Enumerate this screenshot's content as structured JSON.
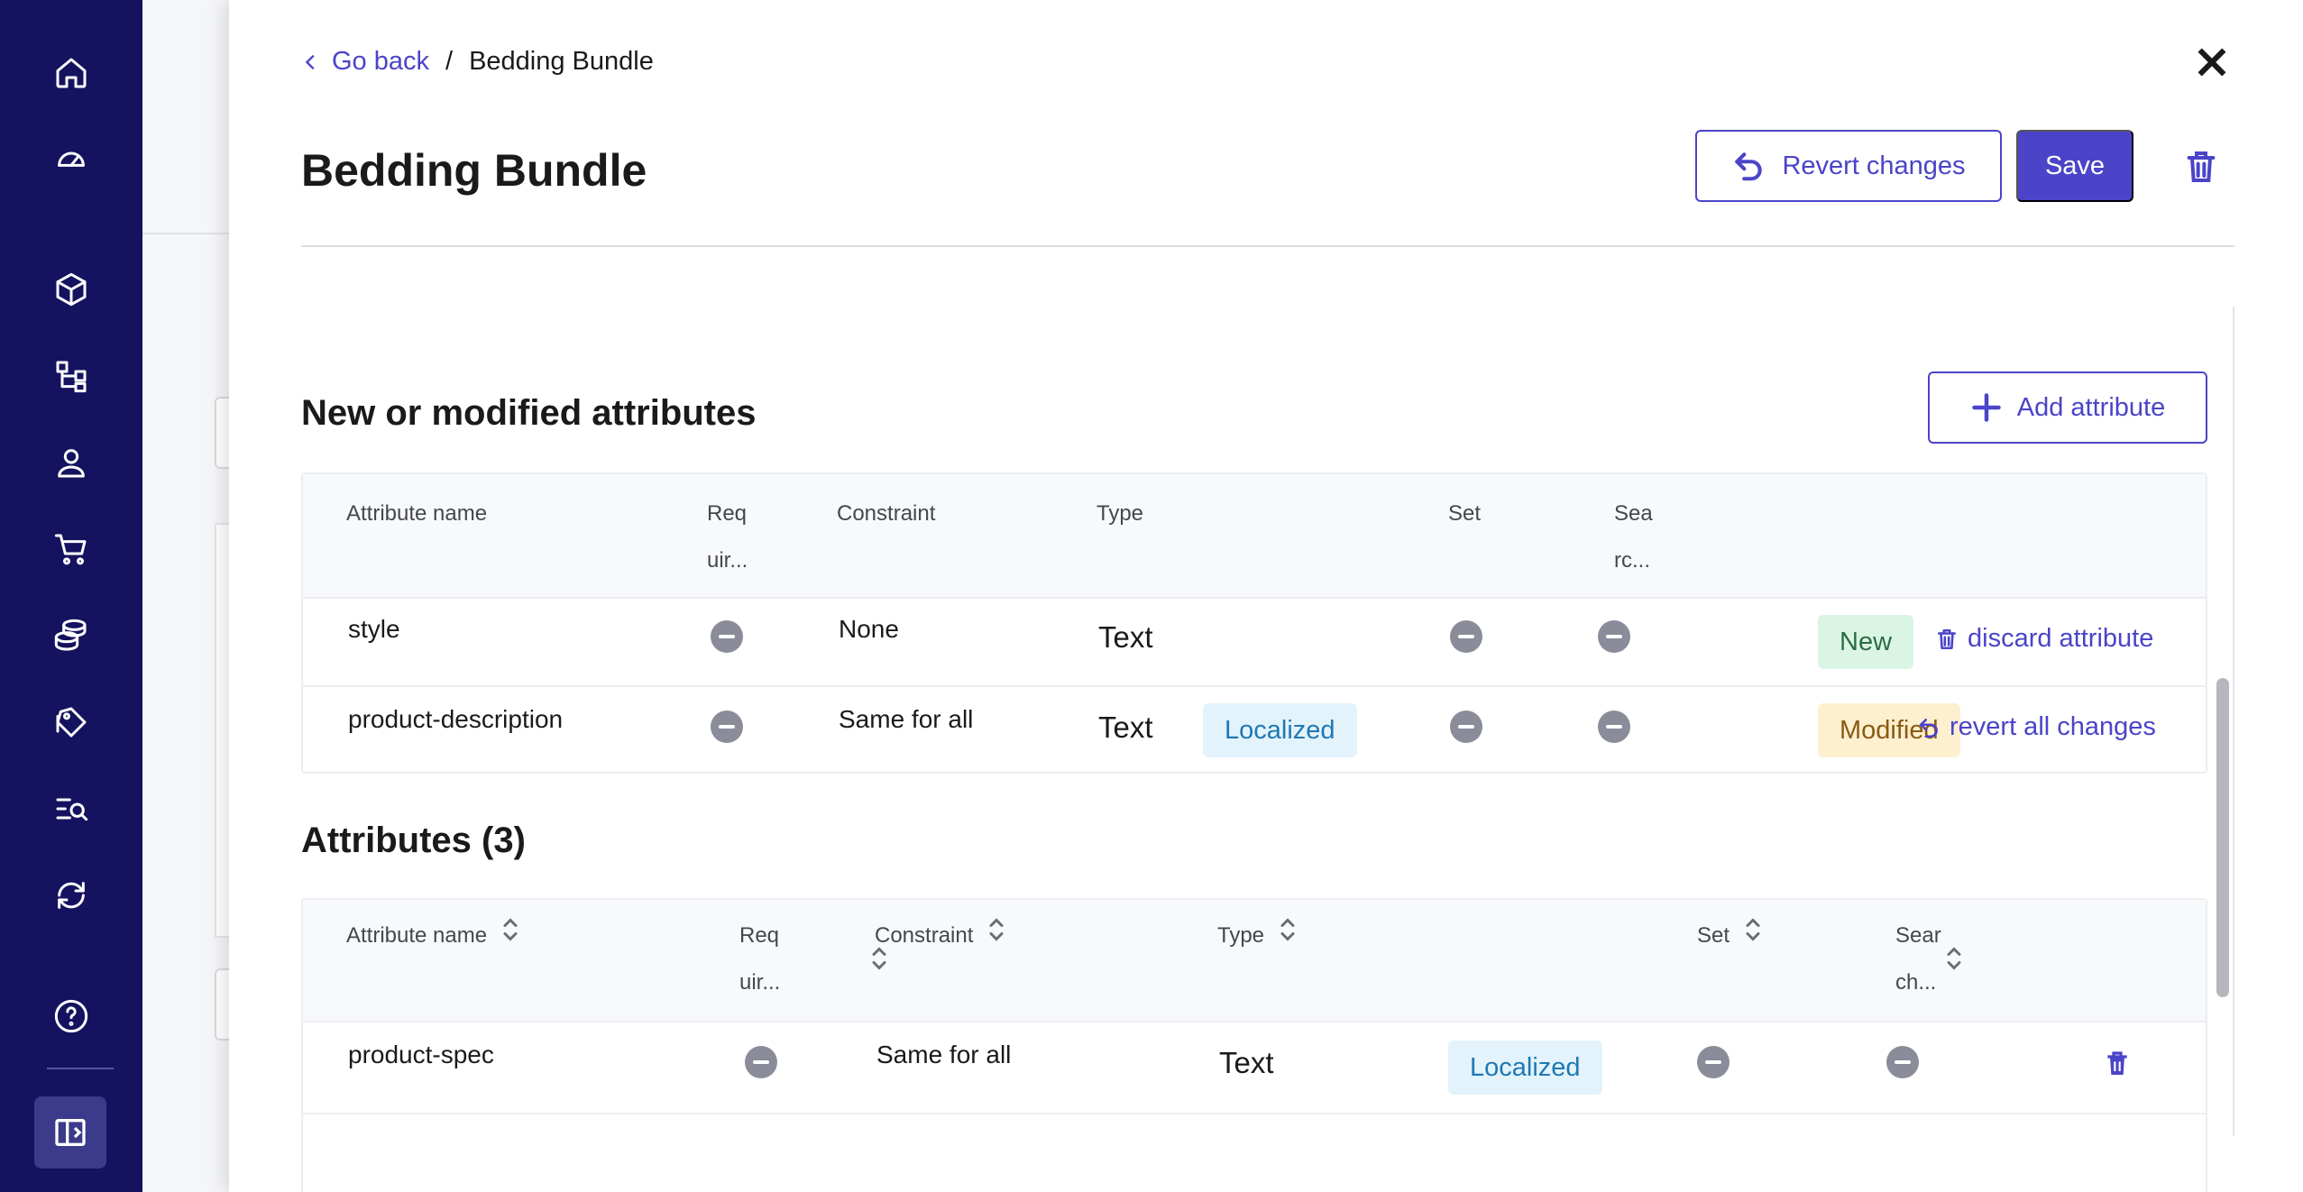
{
  "breadcrumb": {
    "back_label": "Go back",
    "separator": "/",
    "current": "Bedding Bundle"
  },
  "header": {
    "title": "Bedding Bundle",
    "revert_label": "Revert changes",
    "save_label": "Save"
  },
  "colors": {
    "sidebar": "#15135f",
    "accent": "#4b44c8",
    "localized_badge": "#e3f3fb",
    "new_badge": "#daf5e4",
    "modified_badge": "#fdf0cf"
  },
  "sidebar": {
    "icons": [
      "home-icon",
      "dashboard-icon",
      "cube-icon",
      "hierarchy-icon",
      "user-icon",
      "cart-icon",
      "coins-icon",
      "tag-icon",
      "search-list-icon",
      "sync-icon",
      "help-icon",
      "sidebar-toggle-icon"
    ]
  },
  "modified_section": {
    "title": "New or modified attributes",
    "add_label": "Add attribute",
    "columns": {
      "name": "Attribute name",
      "required_1": "Req",
      "required_2": "uir...",
      "constraint": "Constraint",
      "type": "Type",
      "set": "Set",
      "searchable_1": "Sea",
      "searchable_2": "rc..."
    },
    "rows": [
      {
        "name": "style",
        "constraint": "None",
        "type": "Text",
        "status": "New",
        "action": "discard attribute"
      },
      {
        "name": "product-description",
        "constraint": "Same for all",
        "type": "Text",
        "localized": "Localized",
        "status": "Modified",
        "action": "revert all changes"
      }
    ]
  },
  "attributes_section": {
    "title": "Attributes (3)",
    "columns": {
      "name": "Attribute name",
      "required_1": "Req",
      "required_2": "uir...",
      "constraint": "Constraint",
      "type": "Type",
      "set": "Set",
      "searchable_1": "Sear",
      "searchable_2": "ch..."
    },
    "rows": [
      {
        "name": "product-spec",
        "constraint": "Same for all",
        "type": "Text",
        "localized": "Localized"
      }
    ]
  }
}
